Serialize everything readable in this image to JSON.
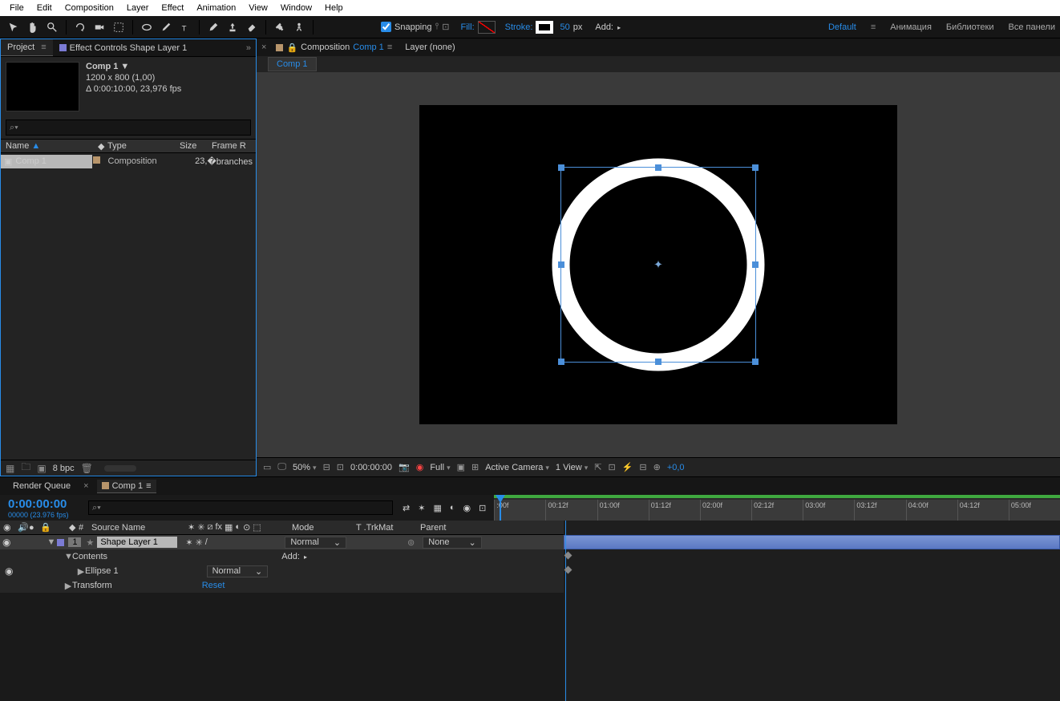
{
  "menubar": [
    "File",
    "Edit",
    "Composition",
    "Layer",
    "Effect",
    "Animation",
    "View",
    "Window",
    "Help"
  ],
  "toolbar": {
    "snapping": "Snapping",
    "fill": "Fill:",
    "stroke": "Stroke:",
    "stroke_val": "50",
    "stroke_unit": "px",
    "add": "Add:"
  },
  "workspace": {
    "default": "Default",
    "anim": "Анимация",
    "lib": "Библиотеки",
    "all": "Все панели"
  },
  "project": {
    "tab": "Project",
    "fx_tab": "Effect Controls Shape Layer 1",
    "comp_name": "Comp 1 ▼",
    "dims": "1200 x 800 (1,00)",
    "duration": "Δ 0:00:10:00, 23,976 fps",
    "cols": {
      "name": "Name",
      "type": "Type",
      "size": "Size",
      "fr": "Frame R"
    },
    "row": {
      "name": "Comp 1",
      "type": "Composition",
      "fr": "23,"
    },
    "bpc": "8 bpc"
  },
  "comp_panel": {
    "prefix": "Composition",
    "name": "Comp 1",
    "layer": "Layer (none)",
    "subtab": "Comp 1"
  },
  "viewer": {
    "zoom": "50%",
    "time": "0:00:00:00",
    "res": "Full",
    "camera": "Active Camera",
    "views": "1 View",
    "exp": "+0,0"
  },
  "timeline": {
    "render_q": "Render Queue",
    "comp": "Comp 1",
    "time_big": "0:00:00:00",
    "time_small": "00000 (23.976 fps)",
    "cols": {
      "src": "Source Name",
      "mode": "Mode",
      "trkmat": "T .TrkMat",
      "parent": "Parent",
      "num": "#"
    },
    "layer": {
      "num": "1",
      "name": "Shape Layer 1",
      "mode": "Normal",
      "parent": "None"
    },
    "contents": "Contents",
    "add": "Add:",
    "ellipse": "Ellipse 1",
    "ellipse_mode": "Normal",
    "transform": "Transform",
    "reset": "Reset",
    "marks": [
      ":00f",
      "00:12f",
      "01:00f",
      "01:12f",
      "02:00f",
      "02:12f",
      "03:00f",
      "03:12f",
      "04:00f",
      "04:12f",
      "05:00f"
    ]
  }
}
